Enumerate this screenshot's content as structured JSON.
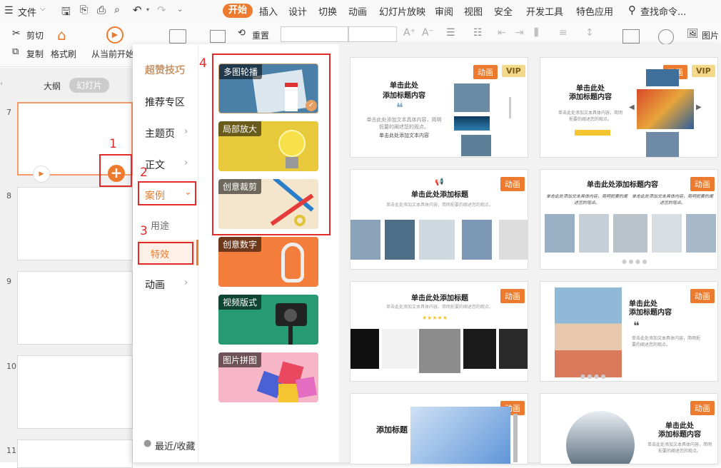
{
  "menubar": {
    "file_label": "文件",
    "tabs": [
      "开始",
      "插入",
      "设计",
      "切换",
      "动画",
      "幻灯片放映",
      "审阅",
      "视图",
      "安全",
      "开发工具",
      "特色应用"
    ],
    "search_label": "查找命令..."
  },
  "ribbon": {
    "cut": "剪切",
    "copy": "复制",
    "format_painter": "格式刷",
    "play_from_current": "从当前开始",
    "reset": "重置",
    "picture": "图片"
  },
  "sidebar": {
    "tab_outline": "大纲",
    "tab_slides": "幻灯片",
    "slide_numbers": [
      "7",
      "8",
      "9",
      "10",
      "11"
    ]
  },
  "categories": {
    "super_tips": "超赞技巧",
    "recommended": "推荐专区",
    "theme_page": "主题页",
    "body": "正文",
    "cases": "案例",
    "usage": "用途",
    "effects": "特效",
    "animation": "动画",
    "recent": "最近/收藏"
  },
  "subcategories": [
    "多图轮播",
    "局部放大",
    "创意裁剪",
    "创意数字",
    "视频版式",
    "图片拼图"
  ],
  "annotations": [
    "1",
    "2",
    "3",
    "4"
  ],
  "preview": {
    "badge_anim": "动画",
    "badge_vip": "VIP",
    "title_click_add": "单击此处添加标题",
    "title_click_add_content_a": "单击此处",
    "title_click_add_content_b": "添加标题内容",
    "title_add": "添加标题",
    "title_click_add_content_full": "单击此处添加标题内容",
    "sample_text": "单击此处添加文本具体内容，简明扼要的阐述您的观点。",
    "small_caption": "单击此处添加文本内容"
  },
  "colors": {
    "accent": "#ec7b2f",
    "annotation_red": "#e02b2b"
  }
}
